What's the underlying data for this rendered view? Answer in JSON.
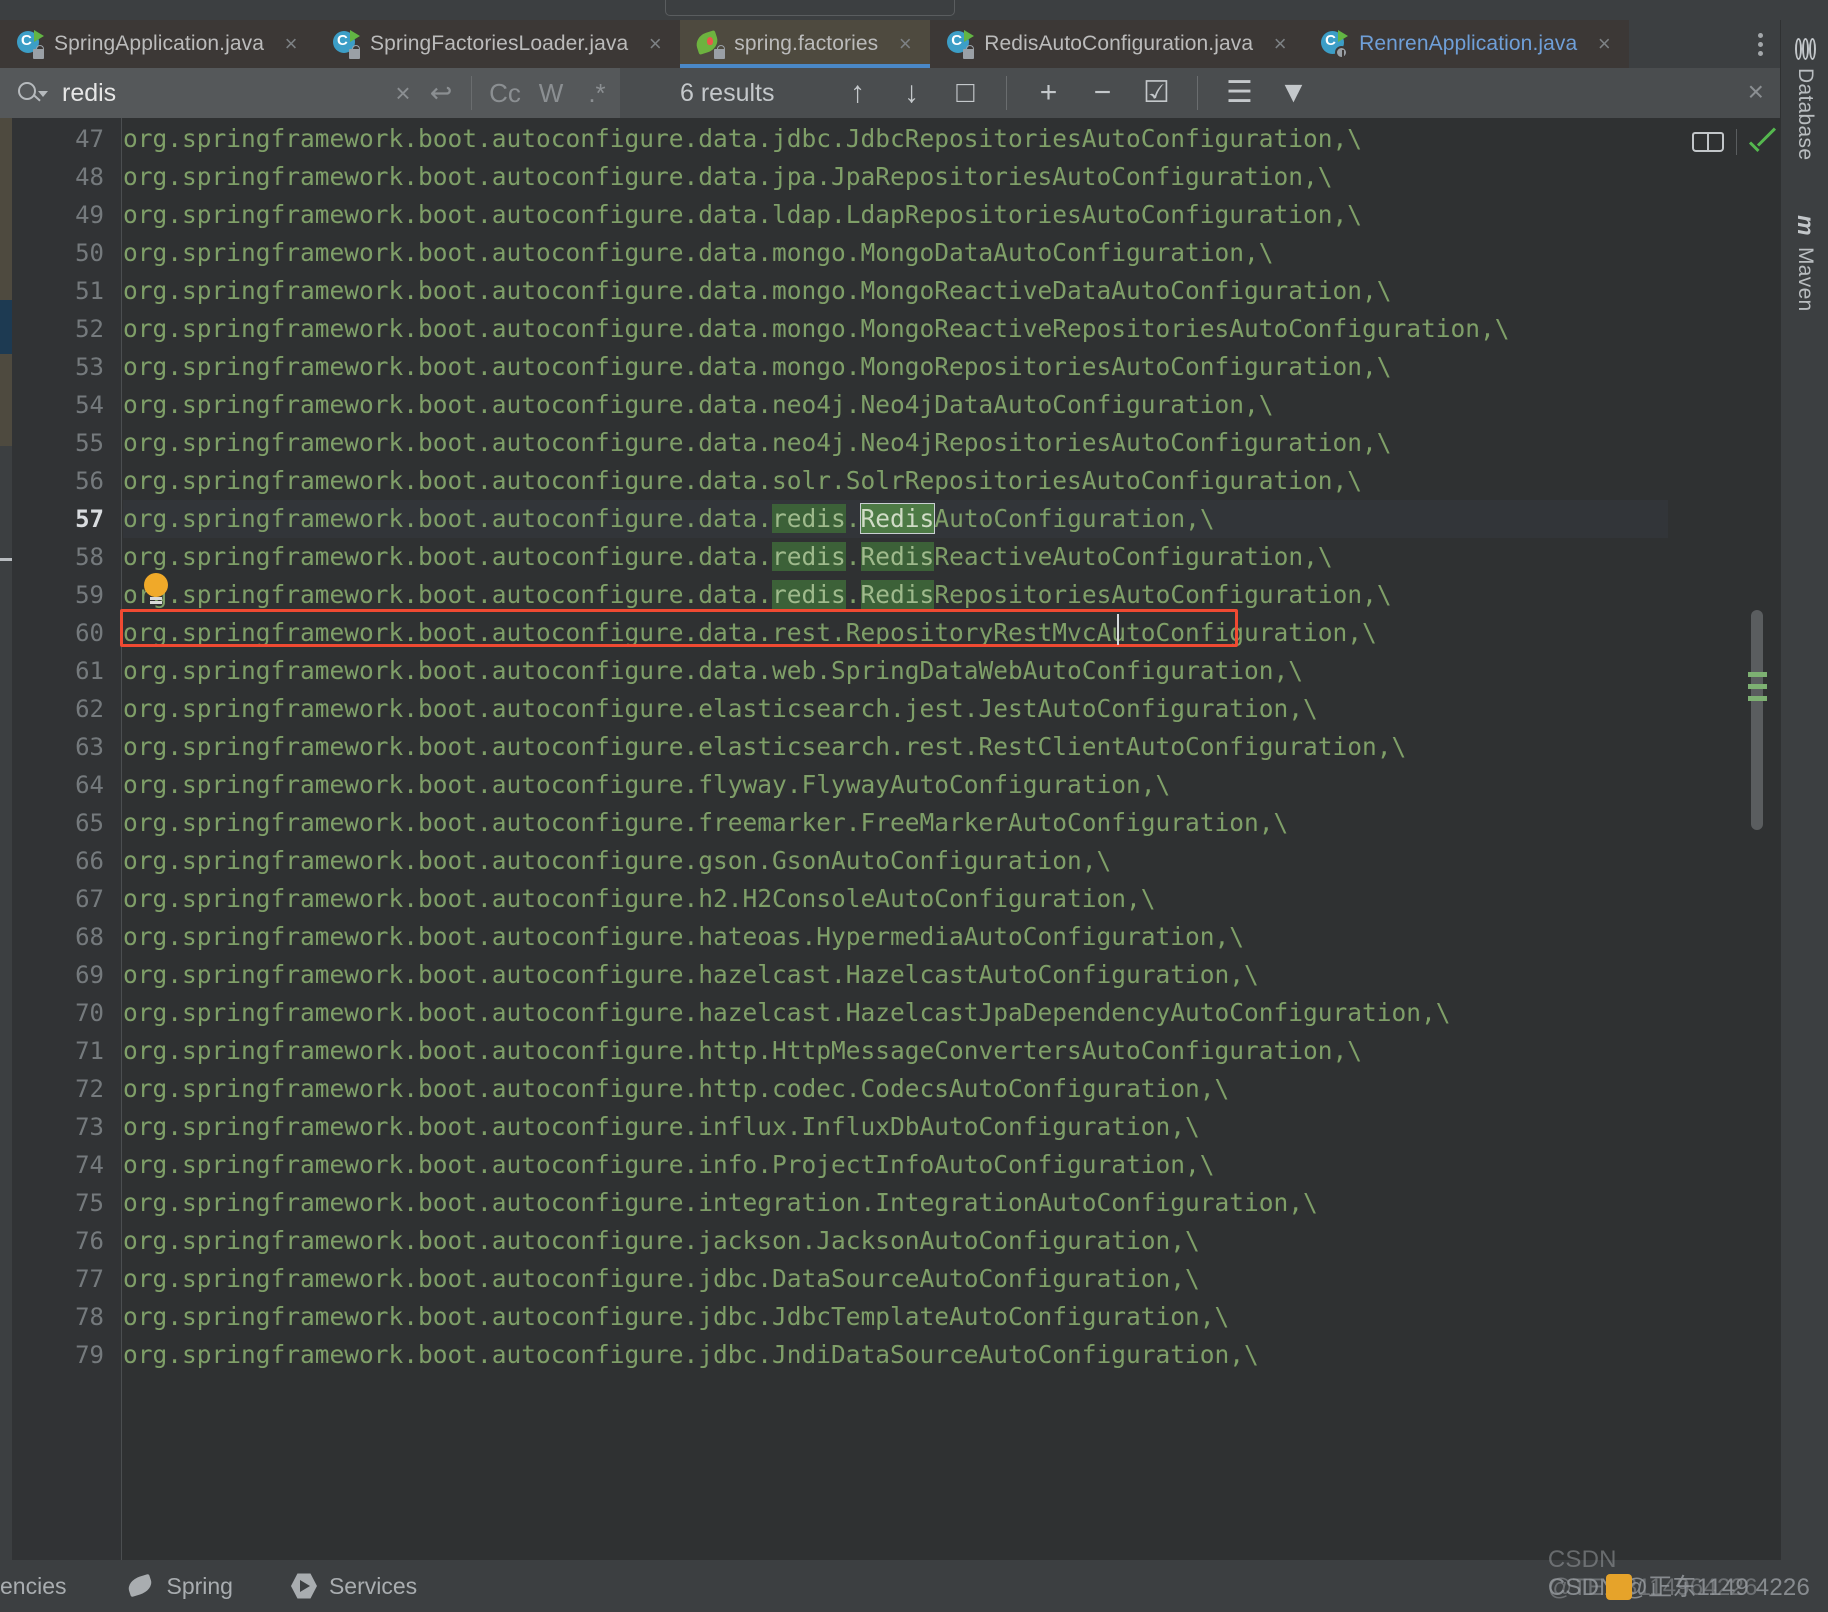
{
  "window": {
    "theme_bg": "#3c3f41",
    "editor_bg": "#2f3132",
    "accent": "#4a88c7",
    "code_color": "#7f9f68",
    "found_box_color": "#f04a32"
  },
  "tabs": [
    {
      "label": "SpringApplication.java",
      "icon": "java-class-file-icon",
      "active": false,
      "close": "×"
    },
    {
      "label": "SpringFactoriesLoader.java",
      "icon": "java-class-file-icon",
      "active": false,
      "close": "×"
    },
    {
      "label": "spring.factories",
      "icon": "spring-factories-file-icon",
      "active": true,
      "close": "×"
    },
    {
      "label": "RedisAutoConfiguration.java",
      "icon": "java-class-file-icon",
      "active": false,
      "close": "×"
    },
    {
      "label": "RenrenApplication.java",
      "icon": "spring-boot-application-icon",
      "active": false,
      "close": "×"
    }
  ],
  "find": {
    "query": "redis",
    "placeholder": "Search",
    "clear_label": "×",
    "regex_return_label": "↩",
    "options": [
      {
        "name": "match-case",
        "label": "Cc"
      },
      {
        "name": "words",
        "label": "W"
      },
      {
        "name": "regex",
        "label": ".*"
      }
    ],
    "results_text": "6 results",
    "prev_label": "↑",
    "next_label": "↓",
    "select_all_label": "□",
    "add_line_label": "+",
    "remove_line_label": "−",
    "select_lines_label": "☑",
    "filter_list_label": "☰",
    "filter_label": "▼",
    "close_label": "×"
  },
  "editor": {
    "first_line_number": 47,
    "current_line": 57,
    "caret_symbol": "|",
    "bulb_line": 56,
    "lines": [
      {
        "n": 47,
        "text": "org.springframework.boot.autoconfigure.data.jdbc.JdbcRepositoriesAutoConfiguration,\\"
      },
      {
        "n": 48,
        "text": "org.springframework.boot.autoconfigure.data.jpa.JpaRepositoriesAutoConfiguration,\\"
      },
      {
        "n": 49,
        "text": "org.springframework.boot.autoconfigure.data.ldap.LdapRepositoriesAutoConfiguration,\\"
      },
      {
        "n": 50,
        "text": "org.springframework.boot.autoconfigure.data.mongo.MongoDataAutoConfiguration,\\"
      },
      {
        "n": 51,
        "text": "org.springframework.boot.autoconfigure.data.mongo.MongoReactiveDataAutoConfiguration,\\"
      },
      {
        "n": 52,
        "text": "org.springframework.boot.autoconfigure.data.mongo.MongoReactiveRepositoriesAutoConfiguration,\\"
      },
      {
        "n": 53,
        "text": "org.springframework.boot.autoconfigure.data.mongo.MongoRepositoriesAutoConfiguration,\\"
      },
      {
        "n": 54,
        "text": "org.springframework.boot.autoconfigure.data.neo4j.Neo4jDataAutoConfiguration,\\"
      },
      {
        "n": 55,
        "text": "org.springframework.boot.autoconfigure.data.neo4j.Neo4jRepositoriesAutoConfiguration,\\"
      },
      {
        "n": 56,
        "text": "org.springframework.boot.autoconfigure.data.solr.SolrRepositoriesAutoConfiguration,\\"
      },
      {
        "n": 57,
        "pre": "org.springframework.boot.autoconfigure.data.",
        "m1": "redis",
        "mid": ".",
        "m2": "Redis",
        "post": "AutoConfiguration,\\",
        "current": true
      },
      {
        "n": 58,
        "pre": "org.springframework.boot.autoconfigure.data.",
        "m1": "redis",
        "mid": ".",
        "m2": "Redis",
        "post": "ReactiveAutoConfiguration,\\"
      },
      {
        "n": 59,
        "pre": "org.springframework.boot.autoconfigure.data.",
        "m1": "redis",
        "mid": ".",
        "m2": "Redis",
        "post": "RepositoriesAutoConfiguration,\\"
      },
      {
        "n": 60,
        "text": "org.springframework.boot.autoconfigure.data.rest.RepositoryRestMvcAutoConfiguration,\\"
      },
      {
        "n": 61,
        "text": "org.springframework.boot.autoconfigure.data.web.SpringDataWebAutoConfiguration,\\"
      },
      {
        "n": 62,
        "text": "org.springframework.boot.autoconfigure.elasticsearch.jest.JestAutoConfiguration,\\"
      },
      {
        "n": 63,
        "text": "org.springframework.boot.autoconfigure.elasticsearch.rest.RestClientAutoConfiguration,\\"
      },
      {
        "n": 64,
        "text": "org.springframework.boot.autoconfigure.flyway.FlywayAutoConfiguration,\\"
      },
      {
        "n": 65,
        "text": "org.springframework.boot.autoconfigure.freemarker.FreeMarkerAutoConfiguration,\\"
      },
      {
        "n": 66,
        "text": "org.springframework.boot.autoconfigure.gson.GsonAutoConfiguration,\\"
      },
      {
        "n": 67,
        "text": "org.springframework.boot.autoconfigure.h2.H2ConsoleAutoConfiguration,\\"
      },
      {
        "n": 68,
        "text": "org.springframework.boot.autoconfigure.hateoas.HypermediaAutoConfiguration,\\"
      },
      {
        "n": 69,
        "text": "org.springframework.boot.autoconfigure.hazelcast.HazelcastAutoConfiguration,\\"
      },
      {
        "n": 70,
        "text": "org.springframework.boot.autoconfigure.hazelcast.HazelcastJpaDependencyAutoConfiguration,\\"
      },
      {
        "n": 71,
        "text": "org.springframework.boot.autoconfigure.http.HttpMessageConvertersAutoConfiguration,\\"
      },
      {
        "n": 72,
        "text": "org.springframework.boot.autoconfigure.http.codec.CodecsAutoConfiguration,\\"
      },
      {
        "n": 73,
        "text": "org.springframework.boot.autoconfigure.influx.InfluxDbAutoConfiguration,\\"
      },
      {
        "n": 74,
        "text": "org.springframework.boot.autoconfigure.info.ProjectInfoAutoConfiguration,\\"
      },
      {
        "n": 75,
        "text": "org.springframework.boot.autoconfigure.integration.IntegrationAutoConfiguration,\\"
      },
      {
        "n": 76,
        "text": "org.springframework.boot.autoconfigure.jackson.JacksonAutoConfiguration,\\"
      },
      {
        "n": 77,
        "text": "org.springframework.boot.autoconfigure.jdbc.DataSourceAutoConfiguration,\\"
      },
      {
        "n": 78,
        "text": "org.springframework.boot.autoconfigure.jdbc.JdbcTemplateAutoConfiguration,\\"
      },
      {
        "n": 79,
        "text": "org.springframework.boot.autoconfigure.jdbc.JndiDataSourceAutoConfiguration,\\"
      }
    ]
  },
  "editor_right": {
    "reader_mode": "book-icon",
    "inspections_status": "check-icon"
  },
  "right_toolwindows": [
    {
      "label": "Database",
      "icon": "database-icon"
    },
    {
      "label": "Maven",
      "icon": "maven-icon"
    }
  ],
  "statusbar": {
    "items": [
      {
        "label": "encies",
        "icon": ""
      },
      {
        "label": "Spring",
        "icon": "spring-leaf-icon"
      },
      {
        "label": "Services",
        "icon": "play-hex-icon"
      }
    ]
  },
  "watermark": {
    "text": "CSDN @正东1149 4226",
    "overlay": "CSDN @TE1/8114964226"
  }
}
